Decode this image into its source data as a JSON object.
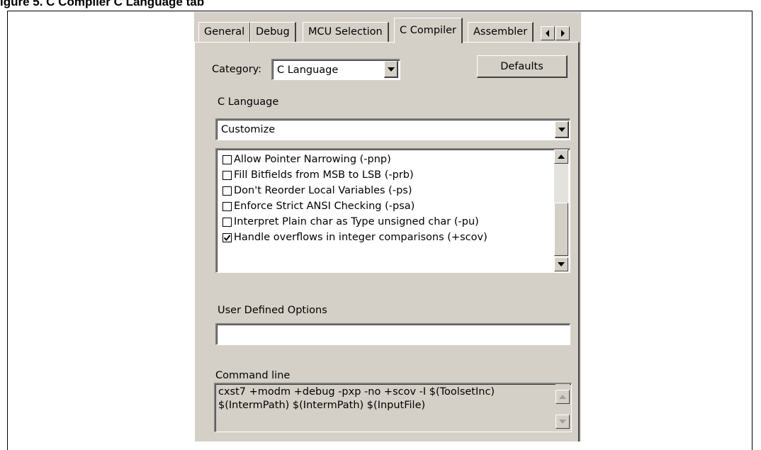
{
  "caption": "igure 5.   C Compiler C Language tab",
  "tabs": [
    {
      "label": "General"
    },
    {
      "label": "Debug"
    },
    {
      "label": "MCU Selection"
    },
    {
      "label": "C Compiler",
      "active": true
    },
    {
      "label": "Assembler"
    }
  ],
  "category": {
    "label": "Category:",
    "value": "C Language"
  },
  "defaults_button": "Defaults",
  "section_title": "C Language",
  "preset": {
    "value": "Customize"
  },
  "options": [
    {
      "label": "Allow Pointer Narrowing (-pnp)",
      "checked": false
    },
    {
      "label": "Fill Bitfields from MSB to LSB (-prb)",
      "checked": false
    },
    {
      "label": "Don't Reorder Local Variables (-ps)",
      "checked": false
    },
    {
      "label": "Enforce Strict ANSI Checking (-psa)",
      "checked": false
    },
    {
      "label": "Interpret Plain char as Type unsigned char (-pu)",
      "checked": false
    },
    {
      "label": "Handle overflows in integer comparisons (+scov)",
      "checked": true
    }
  ],
  "user_options": {
    "label": "User Defined Options",
    "value": ""
  },
  "command_line": {
    "label": "Command line",
    "line1": "cxst7 +modm +debug -pxp -no +scov -I $(ToolsetInc)",
    "line2": "$(IntermPath) $(IntermPath) $(InputFile)"
  }
}
